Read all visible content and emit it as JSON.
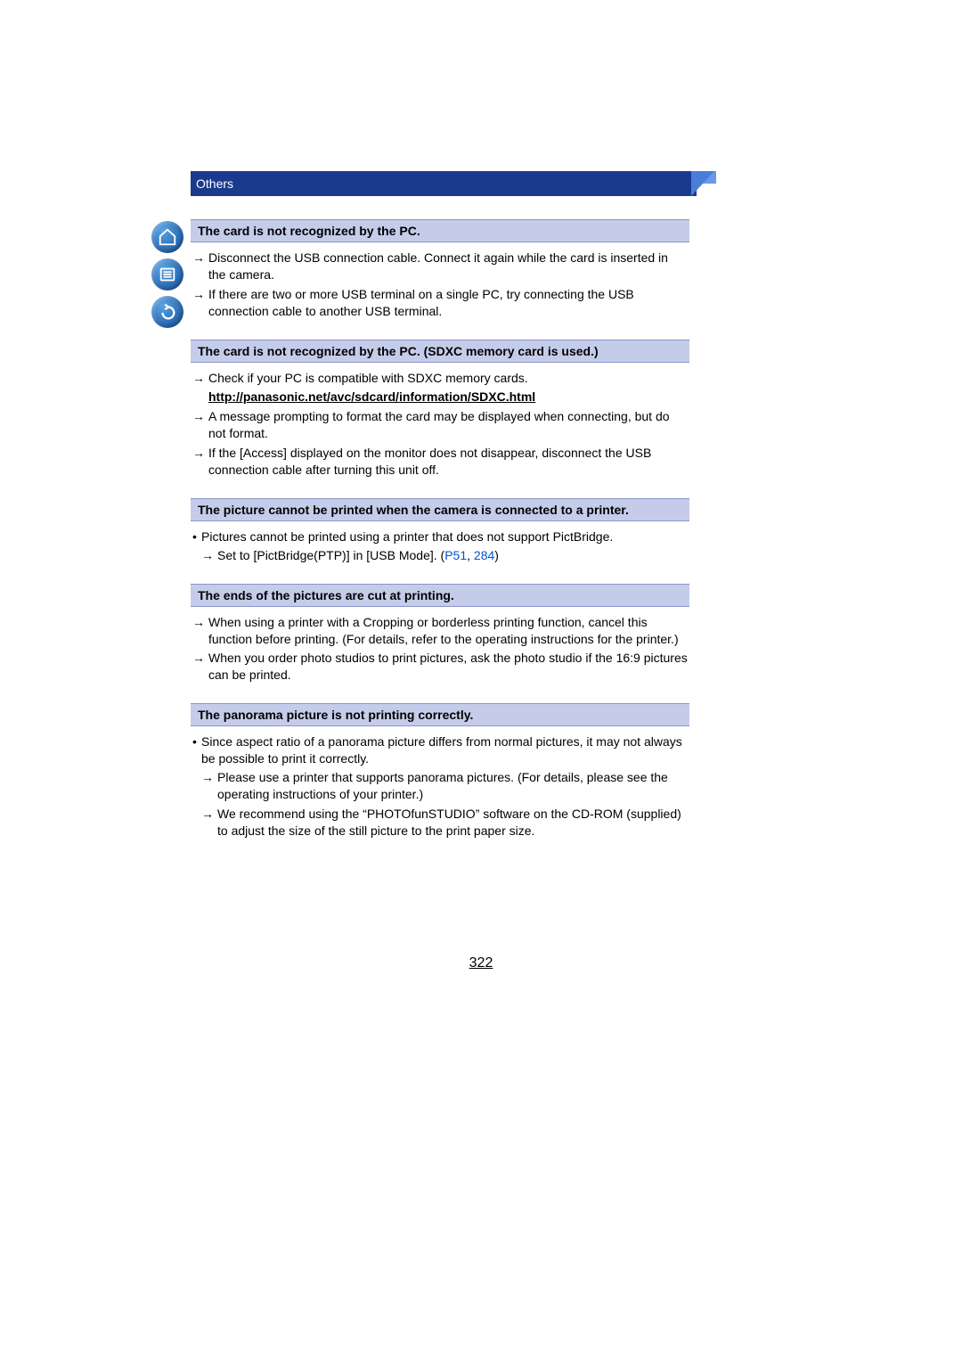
{
  "header": {
    "section": "Others"
  },
  "sidebar": {
    "icons": [
      "home-icon",
      "menu-icon",
      "back-icon"
    ]
  },
  "sections": [
    {
      "title": "The card is not recognized by the PC.",
      "items": [
        {
          "type": "arrow",
          "text": "Disconnect the USB connection cable. Connect it again while the card is inserted in the camera."
        },
        {
          "type": "arrow",
          "text": "If there are two or more USB terminal on a single PC, try connecting the USB connection cable to another USB terminal."
        }
      ]
    },
    {
      "title": "The card is not recognized by the PC. (SDXC memory card is used.)",
      "items": [
        {
          "type": "arrow",
          "text": "Check if your PC is compatible with SDXC memory cards."
        },
        {
          "type": "url",
          "text": "http://panasonic.net/avc/sdcard/information/SDXC.html"
        },
        {
          "type": "arrow",
          "text": "A message prompting to format the card may be displayed when connecting, but do not format."
        },
        {
          "type": "arrow",
          "text": "If the [Access] displayed on the monitor does not disappear, disconnect the USB connection cable after turning this unit off."
        }
      ]
    },
    {
      "title": "The picture cannot be printed when the camera is connected to a printer.",
      "items": [
        {
          "type": "bullet",
          "text": "Pictures cannot be printed using a printer that does not support PictBridge."
        },
        {
          "type": "arrow_nested",
          "text": "Set to [PictBridge(PTP)] in [USB Mode]. ",
          "ref1": "P51",
          "sep": ", ",
          "ref2": "284",
          "tail": ")"
        }
      ]
    },
    {
      "title": "The ends of the pictures are cut at printing.",
      "items": [
        {
          "type": "arrow",
          "text": "When using a printer with a Cropping or borderless printing function, cancel this function before printing. (For details, refer to the operating instructions for the printer.)"
        },
        {
          "type": "arrow",
          "text": "When you order photo studios to print pictures, ask the photo studio if the 16:9 pictures can be printed."
        }
      ]
    },
    {
      "title": "The panorama picture is not printing correctly.",
      "items": [
        {
          "type": "bullet",
          "text": "Since aspect ratio of a panorama picture differs from normal pictures, it may not always be possible to print it correctly."
        },
        {
          "type": "arrow_nested",
          "text": "Please use a printer that supports panorama pictures. (For details, please see the operating instructions of your printer.)"
        },
        {
          "type": "arrow_nested",
          "text": "We recommend using the “PHOTOfunSTUDIO” software on the CD-ROM (supplied) to adjust the size of the still picture to the print paper size."
        }
      ]
    }
  ],
  "page_number": "322",
  "arrow_glyph": "→",
  "bullet_glyph": "•",
  "ref_open": "("
}
